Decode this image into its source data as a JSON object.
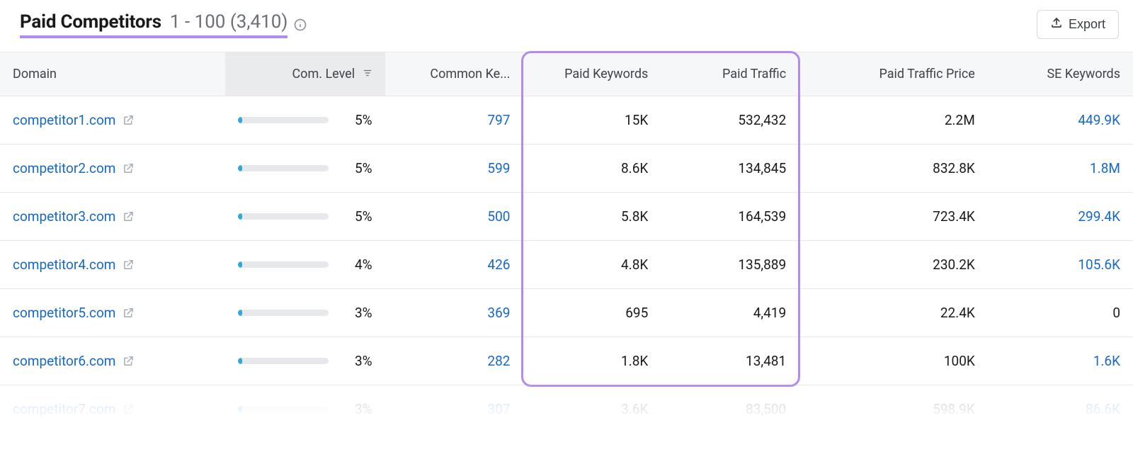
{
  "header": {
    "title": "Paid Competitors",
    "range": "1 - 100 (3,410)",
    "export_label": "Export"
  },
  "columns": {
    "domain": "Domain",
    "com_level": "Com. Level",
    "common_keywords": "Common Ke...",
    "paid_keywords": "Paid Keywords",
    "paid_traffic": "Paid Traffic",
    "paid_traffic_price": "Paid Traffic Price",
    "se_keywords": "SE Keywords"
  },
  "rows": [
    {
      "domain": "competitor1.com",
      "com_level_pct": 5,
      "com_level_label": "5%",
      "common_keywords": "797",
      "paid_keywords": "15K",
      "paid_traffic": "532,432",
      "paid_traffic_price": "2.2M",
      "se_keywords": "449.9K"
    },
    {
      "domain": "competitor2.com",
      "com_level_pct": 5,
      "com_level_label": "5%",
      "common_keywords": "599",
      "paid_keywords": "8.6K",
      "paid_traffic": "134,845",
      "paid_traffic_price": "832.8K",
      "se_keywords": "1.8M"
    },
    {
      "domain": "competitor3.com",
      "com_level_pct": 5,
      "com_level_label": "5%",
      "common_keywords": "500",
      "paid_keywords": "5.8K",
      "paid_traffic": "164,539",
      "paid_traffic_price": "723.4K",
      "se_keywords": "299.4K"
    },
    {
      "domain": "competitor4.com",
      "com_level_pct": 4,
      "com_level_label": "4%",
      "common_keywords": "426",
      "paid_keywords": "4.8K",
      "paid_traffic": "135,889",
      "paid_traffic_price": "230.2K",
      "se_keywords": "105.6K"
    },
    {
      "domain": "competitor5.com",
      "com_level_pct": 3,
      "com_level_label": "3%",
      "common_keywords": "369",
      "paid_keywords": "695",
      "paid_traffic": "4,419",
      "paid_traffic_price": "22.4K",
      "se_keywords": "0"
    },
    {
      "domain": "competitor6.com",
      "com_level_pct": 3,
      "com_level_label": "3%",
      "common_keywords": "282",
      "paid_keywords": "1.8K",
      "paid_traffic": "13,481",
      "paid_traffic_price": "100K",
      "se_keywords": "1.6K"
    },
    {
      "domain": "competitor7.com",
      "com_level_pct": 3,
      "com_level_label": "3%",
      "common_keywords": "307",
      "paid_keywords": "3.6K",
      "paid_traffic": "83,500",
      "paid_traffic_price": "598.9K",
      "se_keywords": "86.6K",
      "faded": true
    }
  ],
  "highlight_columns": [
    "paid_keywords",
    "paid_traffic"
  ]
}
